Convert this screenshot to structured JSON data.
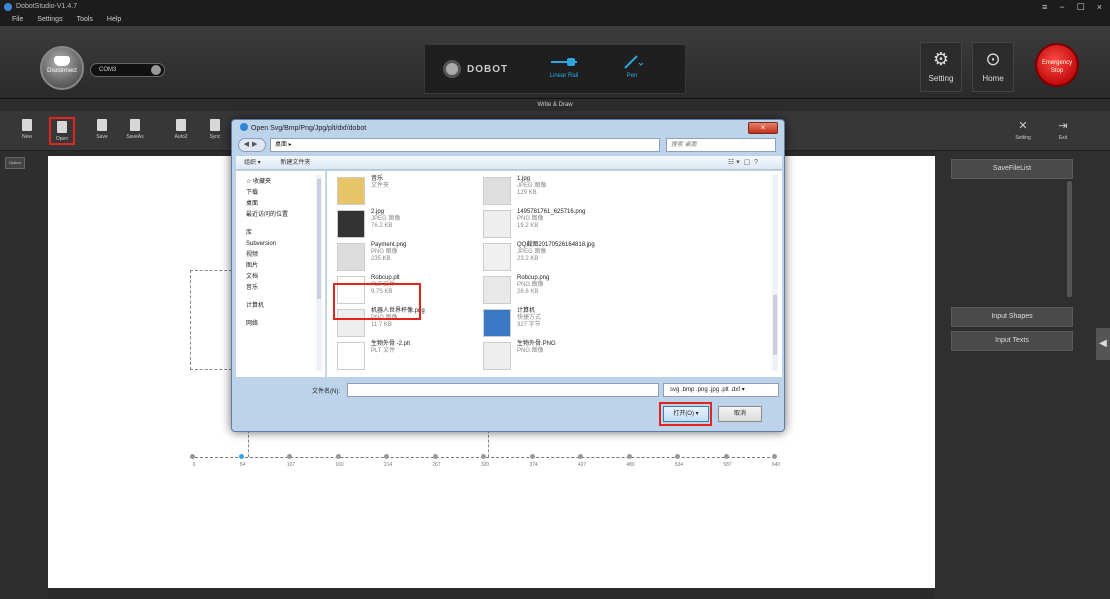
{
  "app": {
    "title": "DobotStudio-V1.4.7",
    "menu": [
      "File",
      "Settings",
      "Tools",
      "Help"
    ],
    "window_controls": [
      "≡",
      "−",
      "☐",
      "×"
    ]
  },
  "topbar": {
    "disconnect_label": "Disconnect",
    "port_value": "COM3",
    "brand": "DOBOT",
    "mode_linear": "Linear Rail",
    "mode_pen": "Pen",
    "setting_label": "Setting",
    "home_label": "Home",
    "stop_label": "Emergency Stop",
    "accent": "#2ea7e0",
    "stop_color": "#e0241e"
  },
  "subtitle": "Write & Draw",
  "toolbar": {
    "items": [
      "New",
      "Open",
      "Save",
      "SaveAs",
      "Auto2",
      "Sync"
    ],
    "right_items": [
      "Setting",
      "Exit"
    ]
  },
  "leftstrip_tag": "Option",
  "axis_ticks": [
    "0",
    "54",
    "107",
    "160",
    "214",
    "267",
    "320",
    "374",
    "427",
    "480",
    "534",
    "587",
    "640"
  ],
  "right_panel": {
    "save_list": "SaveFileList",
    "input_shapes": "Input Shapes",
    "input_texts": "Input Texts"
  },
  "dialog": {
    "title": "Open Svg/Bmp/Png/Jpg/plt/dxf/dobot",
    "path": "桌面 ▸",
    "search_placeholder": "搜索 桌面",
    "organize": "组织 ▾",
    "new_folder": "新建文件夹",
    "nav": [
      "☆ 收藏夹",
      "下载",
      "桌面",
      "最近访问的位置",
      "",
      "库",
      "Subversion",
      "视频",
      "图片",
      "文档",
      "音乐",
      "",
      "计算机",
      "",
      "网络"
    ],
    "files": [
      {
        "name": "音乐",
        "type": "文件夹",
        "size": ""
      },
      {
        "name": "1.jpg",
        "type": "JPEG 图像",
        "size": "129 KB"
      },
      {
        "name": "2.jpg",
        "type": "JPEG 图像",
        "size": "76.2 KB"
      },
      {
        "name": "1495781761_625716.png",
        "type": "PNG 图像",
        "size": "19.2 KB"
      },
      {
        "name": "Payment.png",
        "type": "PNG 图像",
        "size": "235 KB"
      },
      {
        "name": "QQ截图20170526164818.jpg",
        "type": "JPEG 图像",
        "size": "23.2 KB"
      },
      {
        "name": "Robcup.plt",
        "type": "PLT 文件",
        "size": "9.75 KB"
      },
      {
        "name": "Robcup.png",
        "type": "PNG 图像",
        "size": "26.6 KB"
      },
      {
        "name": "机器人世界杯像.png",
        "type": "PNG 图像",
        "size": "11.7 KB"
      },
      {
        "name": "计算机",
        "type": "快捷方式",
        "size": "327 字节"
      },
      {
        "name": "生物外骨 -2.plt",
        "type": "PLT 文件",
        "size": ""
      },
      {
        "name": "生物外骨.PNG",
        "type": "PNG 图像",
        "size": ""
      }
    ],
    "filename_label": "文件名(N):",
    "filename_value": "",
    "filetype": "svg .bmp .png .jpg .plt .dxf",
    "open_label": "打开(O)",
    "cancel_label": "取消"
  }
}
